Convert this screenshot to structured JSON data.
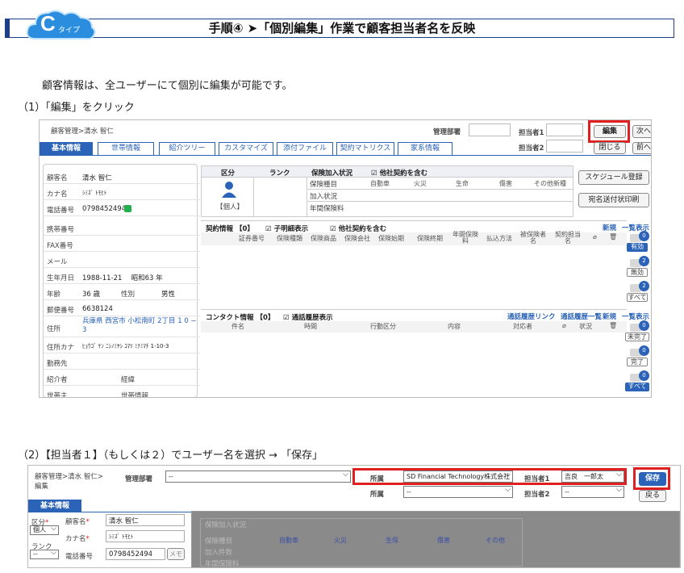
{
  "header": {
    "badge_letter": "C",
    "badge_sub": "タイプ",
    "title": "手順④ ➤「個別編集」作業で顧客担当者名を反映"
  },
  "intro": "顧客情報は、全ユーザーにて個別に編集が可能です。",
  "step1_label": "（1）「編集」をクリック",
  "step2_label": "（2）【担当者１】（もしくは２）でユーザー名を選択 → 「保存」",
  "shot1": {
    "breadcrumb": "顧客管理>清水 智仁",
    "dept_label": "管理部署",
    "tanto1_label": "担当者1",
    "tanto2_label": "担当者2",
    "edit_btn": "編集",
    "next_btn": "次へ",
    "close_btn": "閉じる",
    "prev_btn": "前へ",
    "tabs": [
      "基本情報",
      "世帯情報",
      "紹介ツリー",
      "カスタマイズ",
      "添付ファイル",
      "契約マトリクス",
      "家系情報"
    ],
    "fields": [
      {
        "label": "顧客名",
        "value": "清水 智仁"
      },
      {
        "label": "カナ名",
        "value": "ｼﾐｽﾞ ﾄﾓﾋﾄ"
      },
      {
        "label": "電話番号",
        "value": "0798452494"
      },
      {
        "label": "携帯番号",
        "value": ""
      },
      {
        "label": "FAX番号",
        "value": ""
      },
      {
        "label": "メール",
        "value": ""
      },
      {
        "label": "生年月日",
        "value": "1988-11-21　 昭和63 年"
      },
      {
        "label": "年齢",
        "value": "36 歳"
      },
      {
        "label": "郵便番号",
        "value": "6638124"
      },
      {
        "label": "住所",
        "value": "兵庫県 西宮市 小松南町 2丁目 1 0 − 3"
      },
      {
        "label": "住所カナ",
        "value": "ﾋｮｳｺﾞ ｹﾝ ﾆｼﾉﾐﾔｼ ｺﾏﾂ ﾐﾅﾐﾏﾁ 1-10-3"
      },
      {
        "label": "勤務先",
        "value": ""
      },
      {
        "label": "紹介者",
        "value": ""
      },
      {
        "label": "世帯主",
        "value": ""
      }
    ],
    "gender_label": "性別",
    "gender_value": "男性",
    "keii_label": "経緯",
    "setai_label": "世帯情報",
    "kubun_header": "区分",
    "rank_header": "ランク",
    "kojin": "【個人】",
    "hoken_status": "保険加入状況",
    "other_contract": "他社契約を含む",
    "hoken_rows": [
      "保険種目",
      "加入状況",
      "年間保険料"
    ],
    "hoken_cols": [
      "自動車",
      "火災",
      "生命",
      "傷害",
      "その他新種"
    ],
    "schedule_btn": "スケジュール登録",
    "address_btn": "宛名送付状印刷",
    "contract_title": "契約情報 【0】",
    "contract_child": "子明細表示",
    "contract_other": "他社契約を含む",
    "new_link": "新規",
    "list_link": "一覧表示",
    "contract_cols": [
      "証券番号",
      "保険種類",
      "保険商品",
      "保険会社",
      "保険始期",
      "保険終期",
      "年間保険料",
      "払込方法",
      "被保険者名",
      "契約担当名"
    ],
    "side1": [
      {
        "count": "0",
        "label": "有効"
      },
      {
        "count": "2",
        "label": "無効"
      },
      {
        "count": "2",
        "label": "すべて"
      }
    ],
    "contact_title": "コンタクト情報 【0】",
    "contact_call": "通話履歴表示",
    "call_link": "通話履歴リンク",
    "call_list_link": "通話履歴一覧",
    "contact_cols": [
      "件名",
      "時間",
      "行動区分",
      "内容",
      "対応者",
      "状況"
    ],
    "side2": [
      {
        "count": "0",
        "label": "未完了"
      },
      {
        "count": "0",
        "label": "完了"
      },
      {
        "count": "0",
        "label": "すべて"
      }
    ]
  },
  "shot2": {
    "breadcrumb": "顧客管理>清水 智仁>",
    "breadcrumb2": "編集",
    "dept_label": "管理部署",
    "dept_value": "--",
    "shozoku_label": "所属",
    "shozoku_value": "SD Financial Technology株式会社",
    "shozoku2_value": "--",
    "tanto1_label": "担当者1",
    "tanto1_value": "吉良　一郎太",
    "tanto2_label": "担当者2",
    "tanto2_value": "--",
    "save_btn": "保存",
    "back_btn": "戻る",
    "tab": "基本情報",
    "kubun_label": "区分",
    "kubun_value": "個人",
    "rank_label": "ランク",
    "rank_value": "--",
    "name_label": "顧客名",
    "name_value": "清水 智仁",
    "kana_label": "カナ名",
    "kana_value": "ｼﾐｽﾞ ﾄﾓﾋﾄ",
    "tel_label": "電話番号",
    "tel_value": "0798452494",
    "memo": "メモ",
    "hoken_status": "保険加入状況",
    "hoken_rows": [
      "保険種目",
      "加入件数",
      "年間保険料"
    ],
    "hoken_cols": [
      "自動車",
      "火災",
      "生保",
      "傷害",
      "その他"
    ]
  }
}
